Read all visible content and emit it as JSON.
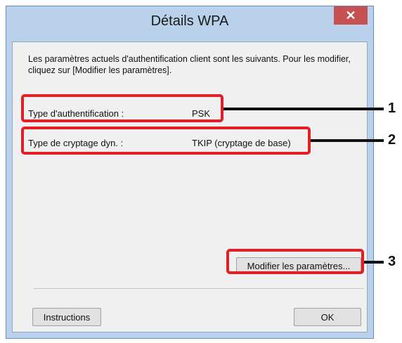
{
  "dialog": {
    "title": "Détails WPA",
    "close_glyph": "✕",
    "intro": "Les paramètres actuels d'authentification client sont les suivants. Pour les modifier, cliquez sur [Modifier les paramètres].",
    "rows": [
      {
        "label": "Type d'authentification :",
        "value": "PSK"
      },
      {
        "label": "Type de cryptage dyn. :",
        "value": "TKIP (cryptage de base)"
      }
    ],
    "modify_button": "Modifier les paramètres...",
    "instructions_button": "Instructions",
    "ok_button": "OK"
  },
  "callouts": [
    "1",
    "2",
    "3"
  ],
  "colors": {
    "window_frame": "#b9d1ea",
    "close_button": "#c75050",
    "callout_border": "#e21f26"
  }
}
